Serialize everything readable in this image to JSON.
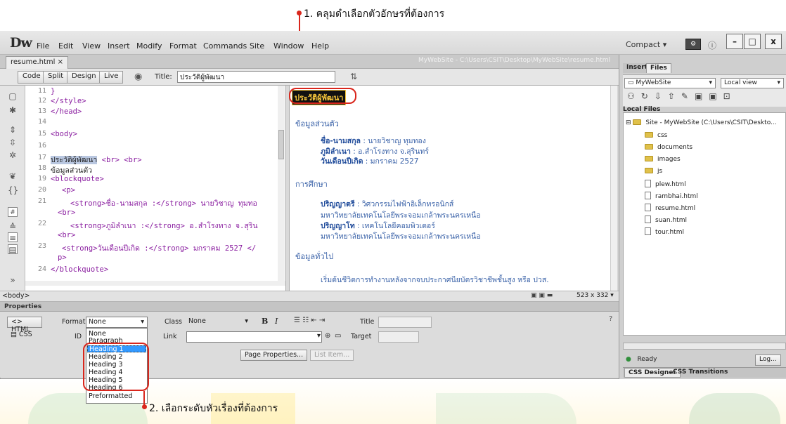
{
  "annotations": {
    "top_label": "1. คลุมดำเลือกตัวอักษรที่ต้องการ",
    "bottom_label": "2. เลือกระดับหัวเรื่องที่ต้องการ"
  },
  "app": {
    "logo": "Dw",
    "menu": [
      "File",
      "Edit",
      "View",
      "Insert",
      "Modify",
      "Format",
      "Commands",
      "Site",
      "Window",
      "Help"
    ],
    "workspace": "Compact",
    "window_controls": [
      "–",
      "□",
      "x"
    ]
  },
  "document": {
    "tab": "resume.html",
    "path": "MyWebSite - C:\\Users\\CSIT\\Desktop\\MyWebSite\\resume.html",
    "view_buttons": [
      "Code",
      "Split",
      "Design",
      "Live"
    ],
    "title_label": "Title:",
    "title_value": "ประวัติผู้พัฒนา"
  },
  "code": [
    {
      "n": "11",
      "t": "}"
    },
    {
      "n": "12",
      "t": "</style>"
    },
    {
      "n": "13",
      "t": "</head>"
    },
    {
      "n": "14",
      "t": ""
    },
    {
      "n": "15",
      "t": "<body>"
    },
    {
      "n": "16",
      "t": ""
    },
    {
      "n": "17",
      "t": "ประวัติผู้พัฒนา <br> <br>"
    },
    {
      "n": "18",
      "t": "ข้อมูลส่วนตัว"
    },
    {
      "n": "19",
      "t": "<blockquote>"
    },
    {
      "n": "20",
      "t": "<p>"
    },
    {
      "n": "21",
      "t": "<strong>ชื่อ-นามสกุล :</strong> นายวิชาญ ทุมทอ"
    },
    {
      "n": "",
      "t": "<br>"
    },
    {
      "n": "22",
      "t": "<strong>ภูมิลำเนา :</strong> อ.สำโรงทาง จ.สุริน"
    },
    {
      "n": "",
      "t": "<br>"
    },
    {
      "n": "23",
      "t": "<strong>วันเดือนปีเกิด :</strong> มกราคม 2527 </"
    },
    {
      "n": "",
      "t": "p>"
    },
    {
      "n": "24",
      "t": "</blockquote>"
    }
  ],
  "design": {
    "heading": "ประวัติผู้พัฒนา",
    "section1": "ข้อมูลส่วนตัว",
    "name_label": "ชื่อ-นามสกุล",
    "name_value": ": นายวิชาญ ทุมทอง",
    "home_label": "ภูมิลำเนา",
    "home_value": ": อ.สำโรงทาง จ.สุรินทร์",
    "birth_label": "วันเดือนปีเกิด",
    "birth_value": ": มกราคม 2527",
    "section2": "การศึกษา",
    "deg1_label": "ปริญญาตรี",
    "deg1_value": ": วิศวกรรมไฟฟ้าอิเล็กทรอนิกส์",
    "deg1_uni": "มหาวิทยาลัยเทคโนโลยีพระจอมเกล้าพระนครเหนือ",
    "deg2_label": "ปริญญาโท",
    "deg2_value": ": เทคโนโลยีคอมพิวเตอร์",
    "deg2_uni": "มหาวิทยาลัยเทคโนโลยีพระจอมเกล้าพระนครเหนือ",
    "section3": "ข้อมูลทั่วไป",
    "general": "เริ่มต้นชีวิตการทำงานหลังจากจบประกาศนียบัตรวิชาชีพชั้นสูง หรือ ปวส."
  },
  "status": {
    "tag": "<body>",
    "size": "523 x 332"
  },
  "properties": {
    "title": "Properties",
    "html_btn": "<> HTML",
    "css_btn": "CSS",
    "format_label": "Format",
    "format_value": "None",
    "id_label": "ID",
    "class_label": "Class",
    "class_value": "None",
    "link_label": "Link",
    "bold": "B",
    "italic": "I",
    "title_label": "Title",
    "target_label": "Target",
    "page_props": "Page Properties...",
    "list_item": "List Item..."
  },
  "format_options": [
    "None",
    "Paragraph",
    "Heading 1",
    "Heading 2",
    "Heading 3",
    "Heading 4",
    "Heading 5",
    "Heading 6",
    "Preformatted"
  ],
  "selected_option": "Heading 1",
  "files_panel": {
    "tabs": [
      "Insert",
      "Files"
    ],
    "site": "MyWebSite",
    "view": "Local view",
    "local_files": "Local Files",
    "root": "Site - MyWebSite (C:\\Users\\CSIT\\Deskto...",
    "folders": [
      "css",
      "documents",
      "images",
      "js"
    ],
    "files": [
      "plew.html",
      "rambhai.html",
      "resume.html",
      "suan.html",
      "tour.html"
    ],
    "ready": "Ready",
    "log": "Log...",
    "bottom_tabs": [
      "CSS Designer",
      "CSS Transitions"
    ]
  }
}
